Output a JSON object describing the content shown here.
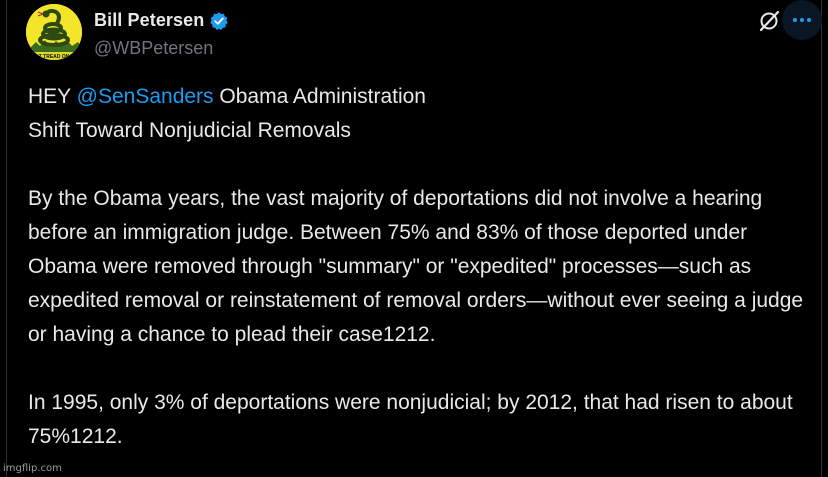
{
  "author": {
    "display_name": "Bill Petersen",
    "handle": "@WBPetersen",
    "verified": true,
    "avatar_icon": "gadsden-flag-avatar"
  },
  "header_actions": {
    "grok_icon": "grok-icon",
    "more_icon": "more-dots-icon"
  },
  "tweet": {
    "line1_prefix": "HEY ",
    "mention": "@SenSanders",
    "line1_suffix": " Obama Administration",
    "line2": "Shift Toward Nonjudicial Removals",
    "paragraph2": "By the Obama years, the vast majority of deportations did not involve a hearing before an immigration judge. Between 75% and 83% of those deported under Obama were removed through \"summary\" or \"expedited\" processes—such as expedited removal or reinstatement of removal orders—without ever seeing a judge or having a chance to plead their case1212.",
    "paragraph3": "In 1995, only 3% of deportations were nonjudicial; by 2012, that had risen to about 75%1212."
  },
  "watermark": "imgflip.com",
  "colors": {
    "background": "#000000",
    "text": "#e7e9ea",
    "muted": "#71767b",
    "accent": "#1d9bf0",
    "avatar_yellow": "#f2e52a"
  }
}
